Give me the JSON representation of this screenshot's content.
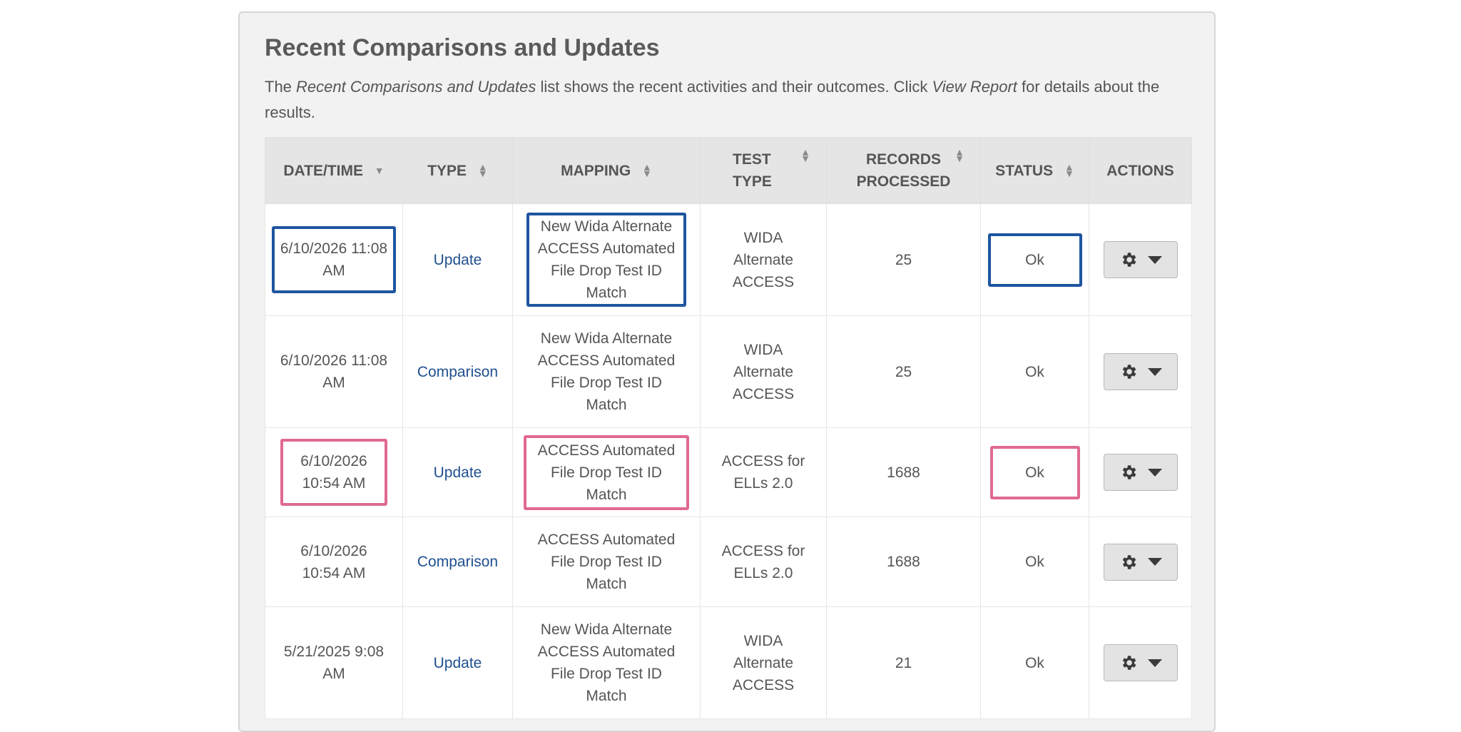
{
  "panel": {
    "title": "Recent Comparisons and Updates",
    "desc_parts": [
      "The ",
      "Recent Comparisons and Updates",
      " list shows the recent activities and their outcomes. Click ",
      "View Report",
      " for details about the results."
    ]
  },
  "table": {
    "headers": [
      "DATE/TIME",
      "TYPE",
      "MAPPING",
      "TEST TYPE",
      "RECORDS PROCESSED",
      "STATUS",
      "ACTIONS"
    ],
    "header_lines": {
      "test_type": [
        "TEST",
        "TYPE"
      ],
      "records": [
        "RECORDS",
        "PROCESSED"
      ]
    },
    "rows": [
      {
        "datetime": [
          "6/10/2026 11:08",
          "AM"
        ],
        "type": "Update",
        "mapping": [
          "New Wida Alternate",
          "ACCESS Automated",
          "File Drop Test ID",
          "Match"
        ],
        "test_type": [
          "WIDA",
          "Alternate",
          "ACCESS"
        ],
        "records": "25",
        "status": "Ok",
        "highlight": "blue"
      },
      {
        "datetime": [
          "6/10/2026 11:08",
          "AM"
        ],
        "type": "Comparison",
        "mapping": [
          "New Wida Alternate",
          "ACCESS Automated",
          "File Drop Test ID",
          "Match"
        ],
        "test_type": [
          "WIDA",
          "Alternate",
          "ACCESS"
        ],
        "records": "25",
        "status": "Ok",
        "highlight": ""
      },
      {
        "datetime": [
          "6/10/2026",
          "10:54 AM"
        ],
        "type": "Update",
        "mapping": [
          "ACCESS Automated",
          "File Drop Test ID",
          "Match"
        ],
        "test_type": [
          "ACCESS for",
          "ELLs 2.0"
        ],
        "records": "1688",
        "status": "Ok",
        "highlight": "pink"
      },
      {
        "datetime": [
          "6/10/2026",
          "10:54 AM"
        ],
        "type": "Comparison",
        "mapping": [
          "ACCESS Automated",
          "File Drop Test ID",
          "Match"
        ],
        "test_type": [
          "ACCESS for",
          "ELLs 2.0"
        ],
        "records": "1688",
        "status": "Ok",
        "highlight": ""
      },
      {
        "datetime": [
          "5/21/2025 9:08",
          "AM"
        ],
        "type": "Update",
        "mapping": [
          "New Wida Alternate",
          "ACCESS Automated",
          "File Drop Test ID",
          "Match"
        ],
        "test_type": [
          "WIDA",
          "Alternate",
          "ACCESS"
        ],
        "records": "21",
        "status": "Ok",
        "highlight": ""
      }
    ]
  },
  "icons": {
    "sort": "sort-icon",
    "sort_desc": "caret-down-icon",
    "action": "gear-icon",
    "dropdown": "chevron-down-icon"
  },
  "colors": {
    "highlight_blue": "#1e55a0",
    "highlight_pink": "#e06a91",
    "link": "#1f4f8f"
  }
}
